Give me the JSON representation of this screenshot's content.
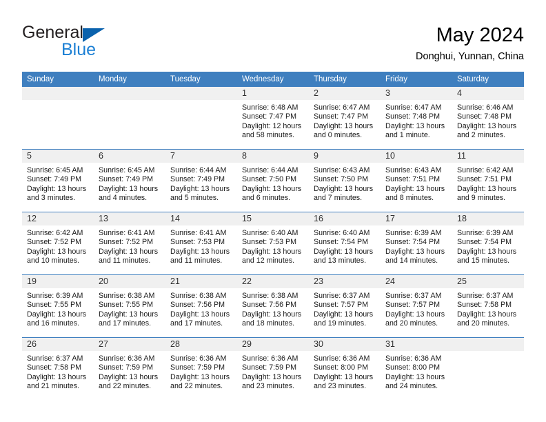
{
  "brand": {
    "name_part1": "General",
    "name_part2": "Blue",
    "triangle_color": "#0a62ad",
    "blue_color": "#1b7fd4",
    "dark_color": "#231f20"
  },
  "header": {
    "title": "May 2024",
    "subtitle": "Donghui, Yunnan, China"
  },
  "theme": {
    "header_band": "#3f7fbf",
    "daynum_band": "#f0f0f0",
    "separator": "#3f7fbf",
    "text": "#1a1a1a"
  },
  "weekdays": [
    "Sunday",
    "Monday",
    "Tuesday",
    "Wednesday",
    "Thursday",
    "Friday",
    "Saturday"
  ],
  "labels": {
    "sunrise_prefix": "Sunrise:",
    "sunset_prefix": "Sunset:",
    "daylight_prefix": "Daylight:"
  },
  "weeks": [
    [
      {
        "day": "",
        "empty": true,
        "line1": "",
        "line2": "",
        "line3": "",
        "line4": ""
      },
      {
        "day": "",
        "empty": true,
        "line1": "",
        "line2": "",
        "line3": "",
        "line4": ""
      },
      {
        "day": "",
        "empty": true,
        "line1": "",
        "line2": "",
        "line3": "",
        "line4": ""
      },
      {
        "day": "1",
        "line1": "Sunrise: 6:48 AM",
        "line2": "Sunset: 7:47 PM",
        "line3": "Daylight: 12 hours",
        "line4": "and 58 minutes."
      },
      {
        "day": "2",
        "line1": "Sunrise: 6:47 AM",
        "line2": "Sunset: 7:47 PM",
        "line3": "Daylight: 13 hours",
        "line4": "and 0 minutes."
      },
      {
        "day": "3",
        "line1": "Sunrise: 6:47 AM",
        "line2": "Sunset: 7:48 PM",
        "line3": "Daylight: 13 hours",
        "line4": "and 1 minute."
      },
      {
        "day": "4",
        "line1": "Sunrise: 6:46 AM",
        "line2": "Sunset: 7:48 PM",
        "line3": "Daylight: 13 hours",
        "line4": "and 2 minutes."
      }
    ],
    [
      {
        "day": "5",
        "line1": "Sunrise: 6:45 AM",
        "line2": "Sunset: 7:49 PM",
        "line3": "Daylight: 13 hours",
        "line4": "and 3 minutes."
      },
      {
        "day": "6",
        "line1": "Sunrise: 6:45 AM",
        "line2": "Sunset: 7:49 PM",
        "line3": "Daylight: 13 hours",
        "line4": "and 4 minutes."
      },
      {
        "day": "7",
        "line1": "Sunrise: 6:44 AM",
        "line2": "Sunset: 7:49 PM",
        "line3": "Daylight: 13 hours",
        "line4": "and 5 minutes."
      },
      {
        "day": "8",
        "line1": "Sunrise: 6:44 AM",
        "line2": "Sunset: 7:50 PM",
        "line3": "Daylight: 13 hours",
        "line4": "and 6 minutes."
      },
      {
        "day": "9",
        "line1": "Sunrise: 6:43 AM",
        "line2": "Sunset: 7:50 PM",
        "line3": "Daylight: 13 hours",
        "line4": "and 7 minutes."
      },
      {
        "day": "10",
        "line1": "Sunrise: 6:43 AM",
        "line2": "Sunset: 7:51 PM",
        "line3": "Daylight: 13 hours",
        "line4": "and 8 minutes."
      },
      {
        "day": "11",
        "line1": "Sunrise: 6:42 AM",
        "line2": "Sunset: 7:51 PM",
        "line3": "Daylight: 13 hours",
        "line4": "and 9 minutes."
      }
    ],
    [
      {
        "day": "12",
        "line1": "Sunrise: 6:42 AM",
        "line2": "Sunset: 7:52 PM",
        "line3": "Daylight: 13 hours",
        "line4": "and 10 minutes."
      },
      {
        "day": "13",
        "line1": "Sunrise: 6:41 AM",
        "line2": "Sunset: 7:52 PM",
        "line3": "Daylight: 13 hours",
        "line4": "and 11 minutes."
      },
      {
        "day": "14",
        "line1": "Sunrise: 6:41 AM",
        "line2": "Sunset: 7:53 PM",
        "line3": "Daylight: 13 hours",
        "line4": "and 11 minutes."
      },
      {
        "day": "15",
        "line1": "Sunrise: 6:40 AM",
        "line2": "Sunset: 7:53 PM",
        "line3": "Daylight: 13 hours",
        "line4": "and 12 minutes."
      },
      {
        "day": "16",
        "line1": "Sunrise: 6:40 AM",
        "line2": "Sunset: 7:54 PM",
        "line3": "Daylight: 13 hours",
        "line4": "and 13 minutes."
      },
      {
        "day": "17",
        "line1": "Sunrise: 6:39 AM",
        "line2": "Sunset: 7:54 PM",
        "line3": "Daylight: 13 hours",
        "line4": "and 14 minutes."
      },
      {
        "day": "18",
        "line1": "Sunrise: 6:39 AM",
        "line2": "Sunset: 7:54 PM",
        "line3": "Daylight: 13 hours",
        "line4": "and 15 minutes."
      }
    ],
    [
      {
        "day": "19",
        "line1": "Sunrise: 6:39 AM",
        "line2": "Sunset: 7:55 PM",
        "line3": "Daylight: 13 hours",
        "line4": "and 16 minutes."
      },
      {
        "day": "20",
        "line1": "Sunrise: 6:38 AM",
        "line2": "Sunset: 7:55 PM",
        "line3": "Daylight: 13 hours",
        "line4": "and 17 minutes."
      },
      {
        "day": "21",
        "line1": "Sunrise: 6:38 AM",
        "line2": "Sunset: 7:56 PM",
        "line3": "Daylight: 13 hours",
        "line4": "and 17 minutes."
      },
      {
        "day": "22",
        "line1": "Sunrise: 6:38 AM",
        "line2": "Sunset: 7:56 PM",
        "line3": "Daylight: 13 hours",
        "line4": "and 18 minutes."
      },
      {
        "day": "23",
        "line1": "Sunrise: 6:37 AM",
        "line2": "Sunset: 7:57 PM",
        "line3": "Daylight: 13 hours",
        "line4": "and 19 minutes."
      },
      {
        "day": "24",
        "line1": "Sunrise: 6:37 AM",
        "line2": "Sunset: 7:57 PM",
        "line3": "Daylight: 13 hours",
        "line4": "and 20 minutes."
      },
      {
        "day": "25",
        "line1": "Sunrise: 6:37 AM",
        "line2": "Sunset: 7:58 PM",
        "line3": "Daylight: 13 hours",
        "line4": "and 20 minutes."
      }
    ],
    [
      {
        "day": "26",
        "line1": "Sunrise: 6:37 AM",
        "line2": "Sunset: 7:58 PM",
        "line3": "Daylight: 13 hours",
        "line4": "and 21 minutes."
      },
      {
        "day": "27",
        "line1": "Sunrise: 6:36 AM",
        "line2": "Sunset: 7:59 PM",
        "line3": "Daylight: 13 hours",
        "line4": "and 22 minutes."
      },
      {
        "day": "28",
        "line1": "Sunrise: 6:36 AM",
        "line2": "Sunset: 7:59 PM",
        "line3": "Daylight: 13 hours",
        "line4": "and 22 minutes."
      },
      {
        "day": "29",
        "line1": "Sunrise: 6:36 AM",
        "line2": "Sunset: 7:59 PM",
        "line3": "Daylight: 13 hours",
        "line4": "and 23 minutes."
      },
      {
        "day": "30",
        "line1": "Sunrise: 6:36 AM",
        "line2": "Sunset: 8:00 PM",
        "line3": "Daylight: 13 hours",
        "line4": "and 23 minutes."
      },
      {
        "day": "31",
        "line1": "Sunrise: 6:36 AM",
        "line2": "Sunset: 8:00 PM",
        "line3": "Daylight: 13 hours",
        "line4": "and 24 minutes."
      },
      {
        "day": "",
        "empty": true,
        "line1": "",
        "line2": "",
        "line3": "",
        "line4": ""
      }
    ]
  ]
}
